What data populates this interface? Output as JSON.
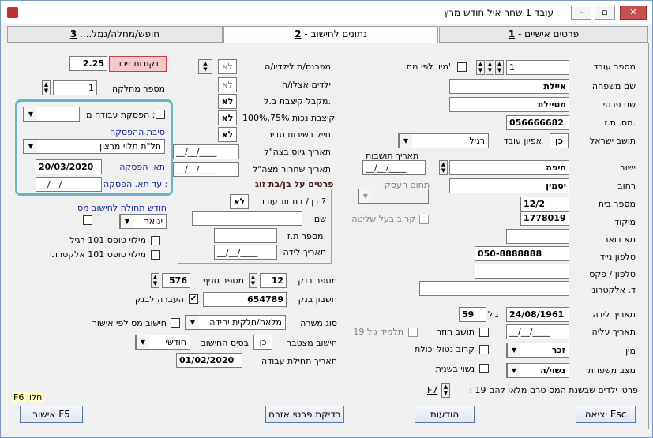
{
  "window": {
    "title": "עובד 1 שחר איל   חודש מרץ",
    "controls": {
      "minimize": "–",
      "restore": "▫",
      "close": "✕"
    }
  },
  "tabs": [
    {
      "num": "1",
      "label": "פרטים אישיים - "
    },
    {
      "num": "2",
      "label": "נתונים לחישוב - "
    },
    {
      "num": "3",
      "label": "חופש/מחלה/גמל.... "
    }
  ],
  "employee": {
    "number_label": "מספר עובד",
    "number": "1",
    "sort_label": "מיון לפי מח'",
    "last_name_label": "שם משפחה",
    "last_name": "איילת",
    "first_name_label": "שם פרטי",
    "first_name": "מטיילת",
    "id_label": "מס. ת.ז.",
    "id": "056666682",
    "resident_label": "תושב ישראל",
    "resident": "כן",
    "character_label": "אפיון עובד",
    "character": "רגיל",
    "settlement_date_label": "תאריך תושבות",
    "settlement_date": "__/__/____",
    "city_label": "ישוב",
    "city": "חיפה",
    "street_label": "רחוב",
    "street": "יסמין",
    "house_label": "מספר בית",
    "house": "12/2",
    "zip_label": "מיקוד",
    "zip": "1778019",
    "po_label": "תא דואר",
    "po": "",
    "mobile_label": "טלפון נייד",
    "mobile": "050-8888888",
    "phone_label": "טלפון / פקס",
    "phone": "",
    "email_label": "ד. אלקטרוני",
    "email": "",
    "business_label": "תחום העסק",
    "controlling_label": "קרוב בעל שליטה",
    "birth_label": "תאריך לידה",
    "birth": "24/08/1961",
    "age_label": "גיל",
    "age": "59",
    "aliya_label": "תאריך עליה",
    "aliya": "__/__/____",
    "returning_label": "תושב חוזר",
    "student_label": "תלמיד גיל 19",
    "gender_label": "מין",
    "gender": "זכר",
    "disabled_label": "קרוב נטול יכולת",
    "marital_label": "מצב משפחתי",
    "marital": "נשוי/ה",
    "married_year_label": "נשוי בשנית",
    "children_label": "פרטי ילדים שבשנת המס טרם מלאו להם 19 :",
    "children_key": "F7"
  },
  "middle": {
    "children_count_label": "מפרנס/ת לילדיו/ה",
    "children_count": "לא",
    "children_with_label": "ילדים אצלו/ה",
    "children_with": "לא",
    "allowance_label": "מקבל קיצבת ב.ל.",
    "allowance": "לא",
    "disability_label": "קיצבת נכות 75%,100%",
    "disability": "לא",
    "soldier_label": "חייל בשירות סדיר",
    "soldier": "לא",
    "army_start_label": "תאריך גיוס בצה\"ל",
    "army_start": "__/__/____",
    "army_end_label": "תאריך שחרור מצה\"ל",
    "army_end": "__/__/____",
    "spouse_title": "פרטים על בן/בת זוג",
    "spouse_works_label": "בן / בת זוג עובד ?",
    "spouse_works": "לא",
    "spouse_name_label": "שם",
    "spouse_name": "",
    "spouse_id_label": "מספר ת.ז.",
    "spouse_id": "",
    "spouse_birth_label": "תאריך לידה",
    "spouse_birth": "__/__/____",
    "bank_label": "מספר בנק",
    "bank": "12",
    "branch_label": "מספר סניף",
    "branch": "576",
    "account_label": "חשבון בנק",
    "account": "654789",
    "transfer_label": "העברה לבנק",
    "job_type_label": "סוג משרה",
    "job_type": "מלאה/חלקית יחידה",
    "tax_approval_label": "חישוב מס לפי אישור",
    "cumulative_label": "חישוב מצטבר",
    "cumulative": "כן",
    "basis_label": "בסיס החישוב",
    "basis": "חודשי",
    "start_date_label": "תאריך תחילת עבודה",
    "start_date": "01/02/2020"
  },
  "left": {
    "credit_label": "נקודות זיכוי",
    "credit": "2.25",
    "dept_label": "מספר מחלקה",
    "dept": "1",
    "stop_label": "הפסקת עבודה מ :",
    "reason_label": "סיבת ההפסקה",
    "reason": "חל\"ת תלוי מרצון",
    "stop_date_label": "תא. הפסקה",
    "stop_date": "20/03/2020",
    "until_label": "עד תא. הפסקה :",
    "until": "__/__/____",
    "tax_month_label": "חודש תחולה לחישוב מס",
    "tax_month": "ינואר",
    "form101_label": "מילוי טופס 101 רגיל",
    "form101e_label": "מילוי טופס 101 אלקטרוני",
    "f6": "F6 חלון"
  },
  "buttons": {
    "exit": "יציאה Esc",
    "messages": "הודעות",
    "citizen": "בדיקת פרטי אזרח",
    "approve": "אישור F5"
  }
}
